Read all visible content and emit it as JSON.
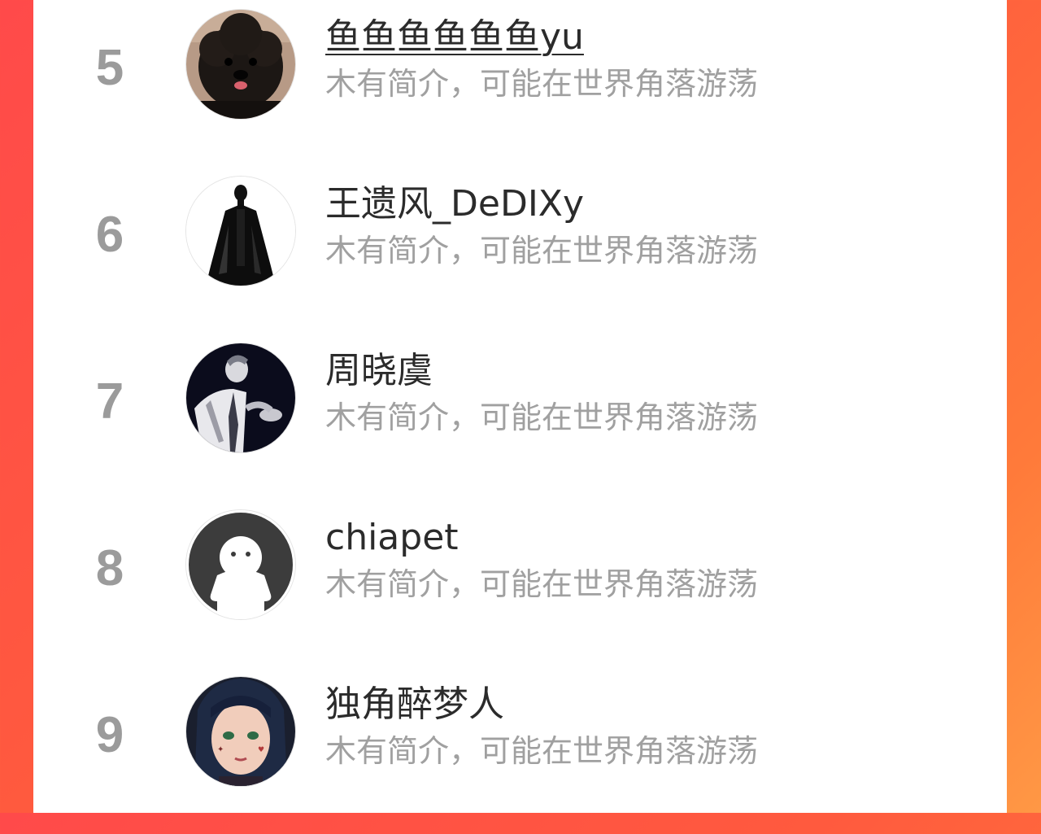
{
  "ranking": {
    "items": [
      {
        "rank": "5",
        "name": "鱼鱼鱼鱼鱼鱼yu",
        "bio": "木有简介，可能在世界角落游荡",
        "avatar_icon": "black-poodle-avatar"
      },
      {
        "rank": "6",
        "name": "王遗风_DeDIXy",
        "bio": "木有简介，可能在世界角落游荡",
        "avatar_icon": "cloaked-figure-avatar"
      },
      {
        "rank": "7",
        "name": "周晓虞",
        "bio": "木有简介，可能在世界角落游荡",
        "avatar_icon": "monochrome-portrait-avatar"
      },
      {
        "rank": "8",
        "name": "chiapet",
        "bio": "木有简介，可能在世界角落游荡",
        "avatar_icon": "default-ghost-avatar"
      },
      {
        "rank": "9",
        "name": "独角醉梦人",
        "bio": "木有简介，可能在世界角落游荡",
        "avatar_icon": "anime-girl-avatar"
      }
    ]
  },
  "colors": {
    "background_gradient_start": "#ff4a4a",
    "background_gradient_end": "#ff9845",
    "panel": "#ffffff",
    "rank_text": "#9b9b9b",
    "name_text": "#2b2b2b",
    "bio_text": "#a0a0a0"
  }
}
